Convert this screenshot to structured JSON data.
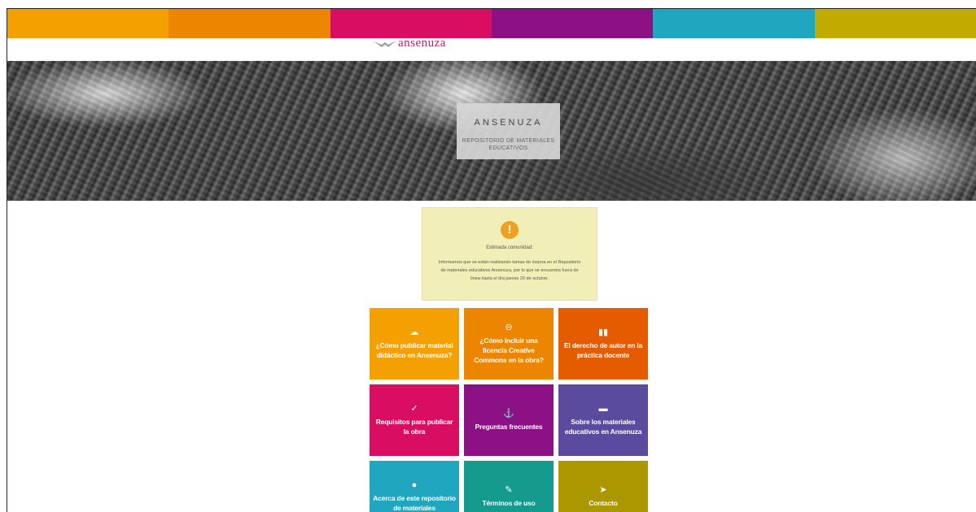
{
  "colorbar": [
    "#f4a000",
    "#ec8600",
    "#d90e63",
    "#8b1185",
    "#21a6bf",
    "#c1ab00"
  ],
  "logo": {
    "text": "ansenuza",
    "color": "#c8185f",
    "icon": "bird-icon"
  },
  "hero": {
    "title": "ANSENUZA",
    "subtitle_line1": "REPOSITORIO DE MATERIALES",
    "subtitle_line2": "EDUCATIVOS"
  },
  "notice": {
    "icon": "exclamation-icon",
    "greeting": "Estimada comunidad:",
    "line1": "Informamos que se están realizando tareas de mejora en el Repositorio",
    "line2": "de materiales educativos Ansenuza, por lo que se encuentra fuera de",
    "line3": "línea hasta el día jueves 20 de octubre."
  },
  "tiles": [
    {
      "icon": "☁",
      "icon_name": "cloud-upload-icon",
      "label": "¿Cómo publicar material didáctico en Ansenuza?",
      "color": "#f4a000"
    },
    {
      "icon": "⊝",
      "icon_name": "creative-commons-icon",
      "label": "¿Cómo incluir una licencia Creative Commons en la obra?",
      "color": "#ec8600"
    },
    {
      "icon": "▮▮",
      "icon_name": "book-icon",
      "label": "El derecho de autor en la práctica docente",
      "color": "#e55c00"
    },
    {
      "icon": "✓",
      "icon_name": "check-circle-icon",
      "label": "Requisitos para publicar la obra",
      "color": "#d90e63"
    },
    {
      "icon": "⚓",
      "icon_name": "anchor-icon",
      "label": "Preguntas frecuentes",
      "color": "#8b1185"
    },
    {
      "icon": "▬",
      "icon_name": "archive-icon",
      "label": "Sobre los materiales educativos en Ansenuza",
      "color": "#5a4b9e"
    },
    {
      "icon": "●",
      "icon_name": "comment-icon",
      "label": "Acerca de este repositorio de materiales",
      "color": "#21a6bf"
    },
    {
      "icon": "✎",
      "icon_name": "pencil-icon",
      "label": "Términos de uso",
      "color": "#159a8e"
    },
    {
      "icon": "➤",
      "icon_name": "rocket-icon",
      "label": "Contacto",
      "color": "#ab9800"
    }
  ]
}
